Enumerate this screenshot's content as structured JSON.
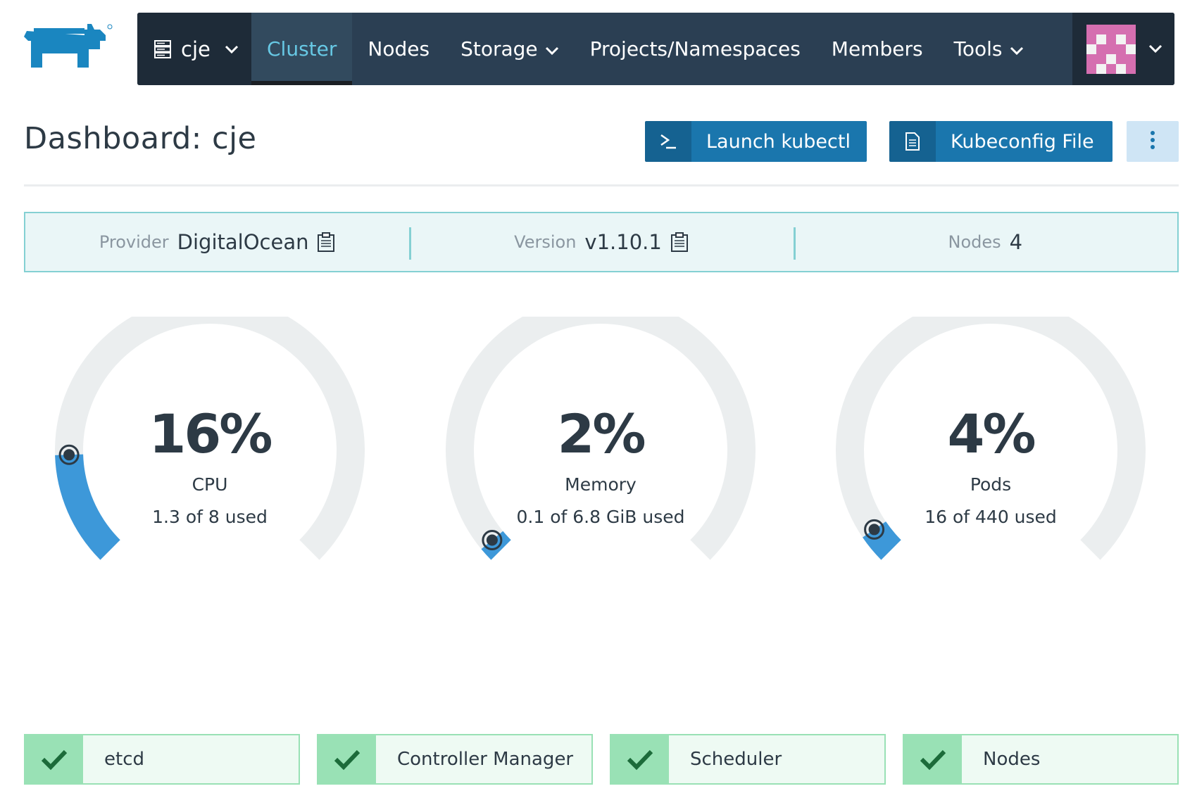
{
  "nav": {
    "cluster_name": "cje",
    "items": [
      {
        "label": "Cluster",
        "active": true,
        "dropdown": false
      },
      {
        "label": "Nodes",
        "active": false,
        "dropdown": false
      },
      {
        "label": "Storage",
        "active": false,
        "dropdown": true
      },
      {
        "label": "Projects/Namespaces",
        "active": false,
        "dropdown": false
      },
      {
        "label": "Members",
        "active": false,
        "dropdown": false
      },
      {
        "label": "Tools",
        "active": false,
        "dropdown": true
      }
    ]
  },
  "header": {
    "title": "Dashboard: cje",
    "launch_kubectl_label": "Launch kubectl",
    "kubeconfig_label": "Kubeconfig File"
  },
  "info": {
    "provider_key": "Provider",
    "provider_value": "DigitalOcean",
    "version_key": "Version",
    "version_value": "v1.10.1",
    "nodes_key": "Nodes",
    "nodes_value": "4"
  },
  "gauges": [
    {
      "percent_label": "16%",
      "percent": 16,
      "name": "CPU",
      "used": "1.3 of 8 used"
    },
    {
      "percent_label": "2%",
      "percent": 2,
      "name": "Memory",
      "used": "0.1 of 6.8 GiB used"
    },
    {
      "percent_label": "4%",
      "percent": 4,
      "name": "Pods",
      "used": "16 of 440 used"
    }
  ],
  "status": [
    {
      "label": "etcd",
      "ok": true
    },
    {
      "label": "Controller Manager",
      "ok": true
    },
    {
      "label": "Scheduler",
      "ok": true
    },
    {
      "label": "Nodes",
      "ok": true
    }
  ],
  "colors": {
    "nav_bg": "#2b3f53",
    "accent_active": "#67c8e4",
    "primary_button": "#1a76ad",
    "gauge_fill": "#3d98d9",
    "gauge_track": "#ebeeef",
    "status_ok": "#99e1b5",
    "check": "#1c6b3a"
  },
  "icons": {
    "logo": "rancher-logo",
    "cluster": "server-icon",
    "dropdown": "chevron-down-icon",
    "kubectl": "terminal-icon",
    "kubeconfig": "file-icon",
    "more": "vertical-dots-icon",
    "copy": "clipboard-icon",
    "status": "check-icon"
  }
}
